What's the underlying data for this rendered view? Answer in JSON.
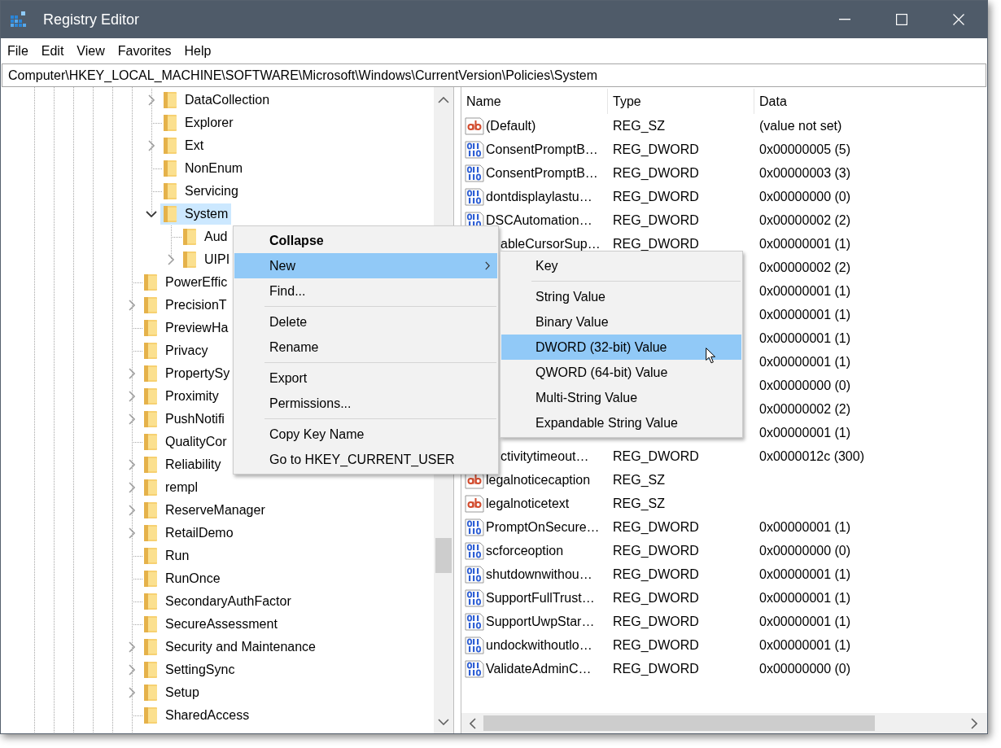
{
  "window": {
    "title": "Registry Editor"
  },
  "menu_bar": [
    "File",
    "Edit",
    "View",
    "Favorites",
    "Help"
  ],
  "address_bar": {
    "value": "Computer\\HKEY_LOCAL_MACHINE\\SOFTWARE\\Microsoft\\Windows\\CurrentVersion\\Policies\\System"
  },
  "tree": {
    "items": [
      {
        "children": [
          {
            "label": "DataCollection",
            "kind": "branch",
            "expanded": false,
            "selected": false
          },
          {
            "label": "Explorer",
            "kind": "leaf",
            "selected": false
          },
          {
            "label": "Ext",
            "kind": "branch",
            "expanded": false,
            "selected": false
          },
          {
            "label": "NonEnum",
            "kind": "leaf",
            "selected": false
          },
          {
            "label": "Servicing",
            "kind": "leaf",
            "selected": false
          },
          {
            "label": "System",
            "kind": "branch",
            "expanded": true,
            "selected": true,
            "children": [
              {
                "label": "Aud",
                "kind": "leaf",
                "selected": false
              },
              {
                "label": "UIPI",
                "kind": "branch",
                "expanded": false,
                "selected": false
              }
            ]
          }
        ]
      },
      {
        "label": "PowerEffic",
        "kind": "leaf",
        "selected": false
      },
      {
        "label": "PrecisionT",
        "kind": "branch",
        "expanded": false,
        "selected": false
      },
      {
        "label": "PreviewHa",
        "kind": "leaf",
        "selected": false
      },
      {
        "label": "Privacy",
        "kind": "leaf",
        "selected": false
      },
      {
        "label": "PropertySy",
        "kind": "branch",
        "expanded": false,
        "selected": false
      },
      {
        "label": "Proximity",
        "kind": "branch",
        "expanded": false,
        "selected": false
      },
      {
        "label": "PushNotifi",
        "kind": "branch",
        "expanded": false,
        "selected": false
      },
      {
        "label": "QualityCor",
        "kind": "leaf",
        "selected": false
      },
      {
        "label": "Reliability",
        "kind": "branch",
        "expanded": false,
        "selected": false
      },
      {
        "label": "rempl",
        "kind": "branch",
        "expanded": false,
        "selected": false
      },
      {
        "label": "ReserveManager",
        "kind": "branch",
        "expanded": false,
        "selected": false
      },
      {
        "label": "RetailDemo",
        "kind": "branch",
        "expanded": false,
        "selected": false
      },
      {
        "label": "Run",
        "kind": "leaf",
        "selected": false
      },
      {
        "label": "RunOnce",
        "kind": "leaf",
        "selected": false
      },
      {
        "label": "SecondaryAuthFactor",
        "kind": "leaf",
        "selected": false
      },
      {
        "label": "SecureAssessment",
        "kind": "leaf",
        "selected": false
      },
      {
        "label": "Security and Maintenance",
        "kind": "branch",
        "expanded": false,
        "selected": false
      },
      {
        "label": "SettingSync",
        "kind": "branch",
        "expanded": false,
        "selected": false
      },
      {
        "label": "Setup",
        "kind": "branch",
        "expanded": false,
        "selected": false
      },
      {
        "label": "SharedAccess",
        "kind": "leaf",
        "selected": false
      }
    ]
  },
  "values_table": {
    "columns": [
      "Name",
      "Type",
      "Data"
    ],
    "rows": [
      {
        "kind": "string",
        "name": "(Default)",
        "type": "REG_SZ",
        "data": "(value not set)"
      },
      {
        "kind": "number",
        "name": "ConsentPromptB…",
        "type": "REG_DWORD",
        "data": "0x00000005 (5)"
      },
      {
        "kind": "number",
        "name": "ConsentPromptB…",
        "type": "REG_DWORD",
        "data": "0x00000003 (3)"
      },
      {
        "kind": "number",
        "name": "dontdisplaylastu…",
        "type": "REG_DWORD",
        "data": "0x00000000 (0)"
      },
      {
        "kind": "number",
        "name": "DSCAutomation…",
        "type": "REG_DWORD",
        "data": "0x00000002 (2)"
      },
      {
        "name": "ableCursorSup…",
        "type": "REG_DWORD",
        "data": "0x00000001 (1)"
      },
      {
        "data": "0x00000002 (2)"
      },
      {
        "data": "0x00000001 (1)"
      },
      {
        "data": "0x00000001 (1)"
      },
      {
        "data": "0x00000001 (1)"
      },
      {
        "data": "0x00000001 (1)"
      },
      {
        "data": "0x00000000 (0)"
      },
      {
        "data": "0x00000002 (2)"
      },
      {
        "data": "0x00000001 (1)"
      },
      {
        "name": "ctivitytimeout…",
        "type": "REG_DWORD",
        "data": "0x0000012c (300)"
      },
      {
        "kind": "string",
        "name": "legalnoticecaption",
        "type": "REG_SZ"
      },
      {
        "kind": "string",
        "name": "legalnoticetext",
        "type": "REG_SZ"
      },
      {
        "kind": "number",
        "name": "PromptOnSecure…",
        "type": "REG_DWORD",
        "data": "0x00000001 (1)"
      },
      {
        "kind": "number",
        "name": "scforceoption",
        "type": "REG_DWORD",
        "data": "0x00000000 (0)"
      },
      {
        "kind": "number",
        "name": "shutdownwithou…",
        "type": "REG_DWORD",
        "data": "0x00000001 (1)"
      },
      {
        "kind": "number",
        "name": "SupportFullTrust…",
        "type": "REG_DWORD",
        "data": "0x00000001 (1)"
      },
      {
        "kind": "number",
        "name": "SupportUwpStar…",
        "type": "REG_DWORD",
        "data": "0x00000001 (1)"
      },
      {
        "kind": "number",
        "name": "undockwithoutlo…",
        "type": "REG_DWORD",
        "data": "0x00000001 (1)"
      },
      {
        "kind": "number",
        "name": "ValidateAdminC…",
        "type": "REG_DWORD",
        "data": "0x00000000 (0)"
      }
    ]
  },
  "context_menu": {
    "items": [
      {
        "kind": "item",
        "label": "Collapse",
        "default": true,
        "selected": false
      },
      {
        "kind": "item",
        "label": "New",
        "default": false,
        "selected": true,
        "submenu": {
          "items": [
            {
              "kind": "item",
              "label": "Key",
              "selected": false
            },
            {
              "kind": "separator"
            },
            {
              "kind": "item",
              "label": "String Value",
              "selected": false
            },
            {
              "kind": "item",
              "label": "Binary Value",
              "selected": false
            },
            {
              "kind": "item",
              "label": "DWORD (32-bit) Value",
              "selected": true
            },
            {
              "kind": "item",
              "label": "QWORD (64-bit) Value",
              "selected": false
            },
            {
              "kind": "item",
              "label": "Multi-String Value",
              "selected": false
            },
            {
              "kind": "item",
              "label": "Expandable String Value",
              "selected": false
            }
          ]
        }
      },
      {
        "kind": "item",
        "label": "Find...",
        "default": false,
        "selected": false
      },
      {
        "kind": "separator"
      },
      {
        "kind": "item",
        "label": "Delete",
        "default": false,
        "selected": false
      },
      {
        "kind": "item",
        "label": "Rename",
        "default": false,
        "selected": false
      },
      {
        "kind": "separator"
      },
      {
        "kind": "item",
        "label": "Export",
        "default": false,
        "selected": false
      },
      {
        "kind": "item",
        "label": "Permissions...",
        "default": false,
        "selected": false
      },
      {
        "kind": "separator"
      },
      {
        "kind": "item",
        "label": "Copy Key Name",
        "default": false,
        "selected": false
      },
      {
        "kind": "item",
        "label": "Go to HKEY_CURRENT_USER",
        "default": false,
        "selected": false
      }
    ]
  }
}
